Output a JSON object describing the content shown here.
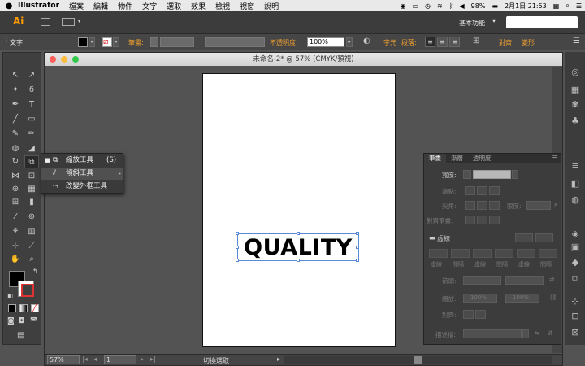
{
  "menubar": {
    "app_name": "Illustrator",
    "menus": [
      "檔案",
      "編輯",
      "物件",
      "文字",
      "選取",
      "效果",
      "檢視",
      "視窗",
      "說明"
    ],
    "battery": "98%",
    "date_time": "2月1日 21:53"
  },
  "appbar": {
    "logo": "Ai",
    "workspace": "基本功能",
    "workspace_caret": "▾"
  },
  "control": {
    "tool_label": "文字",
    "stroke_label": "筆畫:",
    "opacity_label": "不透明度:",
    "opacity_value": "100%",
    "char_label": "字元",
    "para_label": "段落:",
    "align_label": "對齊",
    "transform_label": "變形"
  },
  "flyout": {
    "items": [
      {
        "label": "縮放工具",
        "shortcut": "(S)"
      },
      {
        "label": "傾斜工具",
        "shortcut": ""
      },
      {
        "label": "改變外框工具",
        "shortcut": ""
      }
    ]
  },
  "document": {
    "title": "未命名-2* @ 57% (CMYK/預視)",
    "artwork_text": "QUALITY"
  },
  "status": {
    "zoom": "57%",
    "page": "1",
    "text": "切換選取"
  },
  "stroke_panel": {
    "tabs": [
      "筆畫",
      "漸層",
      "透明度"
    ],
    "weight_label": "寬度:",
    "cap_label": "端點:",
    "corner_label": "尖角:",
    "limit_label": "限度:",
    "align_label": "對齊筆畫:",
    "dash_label": "虛線",
    "dash_cols": [
      "虛線",
      "間隔",
      "虛線",
      "間隔",
      "虛線",
      "間隔"
    ],
    "arrow_label": "箭頭:",
    "scale_label": "縮放:",
    "scale1": "100%",
    "scale2": "100%",
    "arrow_align_label": "對齊:",
    "profile_label": "描述檔:"
  },
  "colors": {
    "accent_orange": "#f0a030",
    "selection_blue": "#5a8ad6",
    "panel_bg": "#3c3c3c"
  }
}
